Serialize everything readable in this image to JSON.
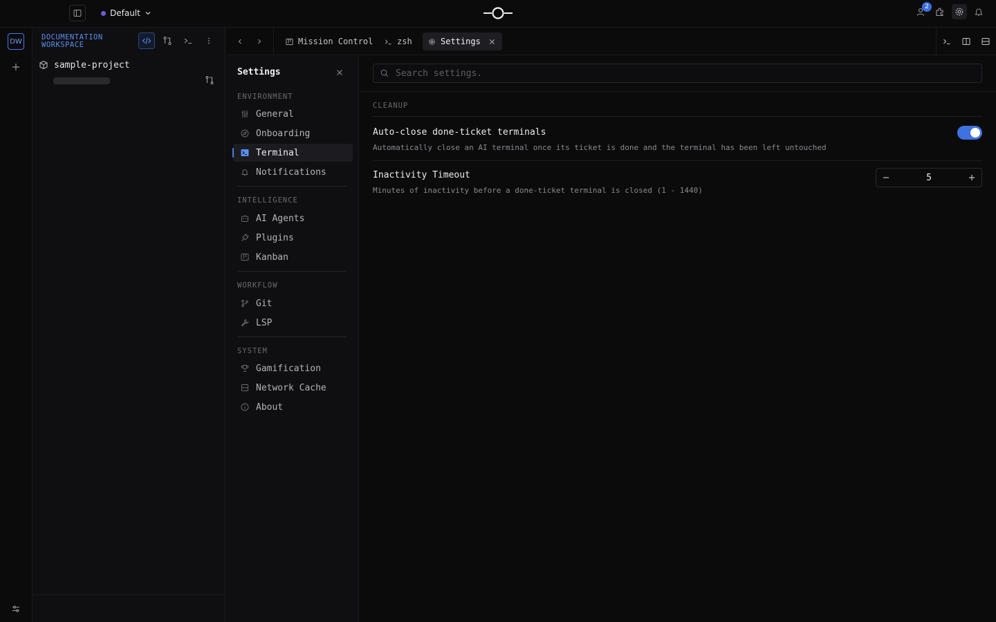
{
  "topbar": {
    "profile_label": "Default",
    "profile_color": "#6a5cd8",
    "notifications_badge": "2",
    "icons": [
      "sidebar-toggle-icon",
      "chevron-down-icon",
      "logo-icon",
      "agents-icon",
      "puzzle-icon",
      "gear-icon",
      "bell-icon"
    ]
  },
  "activity": {
    "workspace_initials": "DW"
  },
  "workspace": {
    "title": "DOCUMENTATION WORKSPACE",
    "project_name": "sample-project"
  },
  "tabs": {
    "items": [
      {
        "label": "Mission Control",
        "icon": "kanban-icon"
      },
      {
        "label": "zsh",
        "icon": "terminal-icon"
      },
      {
        "label": "Settings",
        "icon": "gear-icon",
        "active": true
      }
    ]
  },
  "settings_nav": {
    "title": "Settings",
    "sections": {
      "environment": "ENVIRONMENT",
      "intelligence": "INTELLIGENCE",
      "workflow": "WORKFLOW",
      "system": "SYSTEM"
    },
    "items": {
      "general": "General",
      "onboarding": "Onboarding",
      "terminal": "Terminal",
      "notifications": "Notifications",
      "ai_agents": "AI Agents",
      "plugins": "Plugins",
      "kanban": "Kanban",
      "git": "Git",
      "lsp": "LSP",
      "gamification": "Gamification",
      "network_cache": "Network Cache",
      "about": "About"
    },
    "active_item": "Terminal"
  },
  "main": {
    "search_placeholder": "Search settings.",
    "section_label": "CLEANUP",
    "auto_close": {
      "title": "Auto-close done-ticket terminals",
      "description": "Automatically close an AI terminal once its ticket is done and the terminal has been left untouched",
      "enabled": true
    },
    "inactivity": {
      "title": "Inactivity Timeout",
      "description": "Minutes of inactivity before a done-ticket terminal is closed (1 - 1440)",
      "value": "5",
      "decrement": "−",
      "increment": "+"
    }
  },
  "colors": {
    "accent": "#3e72e0",
    "workspace_title": "#5b8ff0",
    "background": "#0b0b0c"
  }
}
